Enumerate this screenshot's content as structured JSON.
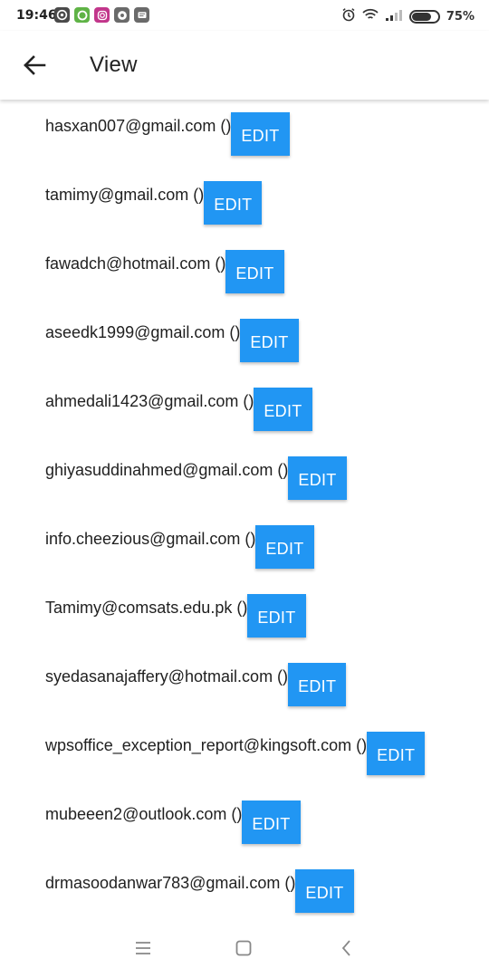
{
  "status_bar": {
    "time": "19:46",
    "battery_percent": "75%",
    "battery_level": 0.75,
    "notification_icons": [
      "github-icon",
      "android-icon",
      "instagram-icon",
      "chrome-icon",
      "message-icon"
    ]
  },
  "app_bar": {
    "title": "View",
    "back_icon": "arrow-left-icon"
  },
  "contacts": [
    {
      "email": "hasxan007@gmail.com ()",
      "button": "EDIT"
    },
    {
      "email": "tamimy@gmail.com ()",
      "button": "EDIT"
    },
    {
      "email": "fawadch@hotmail.com ()",
      "button": "EDIT"
    },
    {
      "email": "aseedk1999@gmail.com ()",
      "button": "EDIT"
    },
    {
      "email": "ahmedali1423@gmail.com ()",
      "button": "EDIT"
    },
    {
      "email": "ghiyasuddinahmed@gmail.com ()",
      "button": "EDIT"
    },
    {
      "email": "info.cheezious@gmail.com ()",
      "button": "EDIT"
    },
    {
      "email": "Tamimy@comsats.edu.pk ()",
      "button": "EDIT"
    },
    {
      "email": "syedasanajaffery@hotmail.com ()",
      "button": "EDIT"
    },
    {
      "email": "wpsoffice_exception_report@kingsoft.com ()",
      "button": "EDIT"
    },
    {
      "email": "mubeeen2@outlook.com ()",
      "button": "EDIT"
    },
    {
      "email": "drmasoodanwar783@gmail.com ()",
      "button": "EDIT"
    }
  ],
  "colors": {
    "accent": "#2196f3",
    "text": "#212121"
  },
  "nav_bar": {
    "icons": [
      "menu-icon",
      "home-square-icon",
      "back-chevron-icon"
    ]
  }
}
